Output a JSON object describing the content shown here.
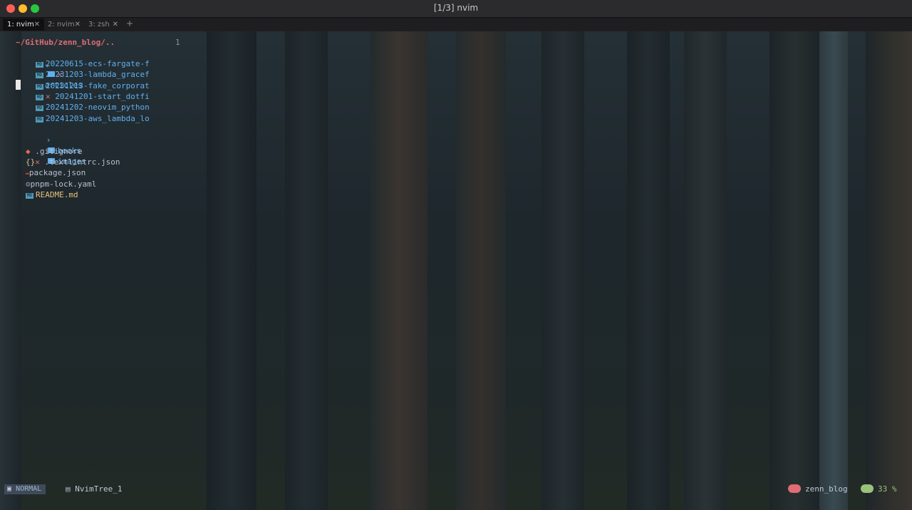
{
  "window": {
    "title": "[1/3] nvim"
  },
  "tabs": [
    {
      "label": "1: nvim",
      "close": "✕"
    },
    {
      "label": "2: nvim",
      "close": "✕"
    },
    {
      "label": "3: zsh",
      "close": "✕"
    }
  ],
  "tab_add": "+",
  "tree": {
    "root": "~/GitHub/zenn_blog/..",
    "line_number": "1",
    "articles": {
      "label": "articles",
      "status": "✕"
    },
    "article_files": [
      "20220615-ecs-fargate-f",
      "20231203-lambda_gracef",
      "20231213-fake_corporat",
      "20241201-start_dotfi",
      "20241202-neovim_python",
      "20241203-aws_lambda_lo"
    ],
    "file_status_mark": "✕",
    "dirs": [
      "books",
      "images"
    ],
    "root_files": {
      "gitignore": ".gitignore",
      "textlint": ".textlintrc.json",
      "package": "package.json",
      "pnpm": "pnpm-lock.yaml",
      "readme": "README.md"
    },
    "icons": {
      "md": "MD",
      "json": "{}",
      "chevron_down": "⌄",
      "chevron_right": "›"
    }
  },
  "statusline": {
    "mode": "NORMAL",
    "file": "NvimTree_1",
    "project": "zenn_blog",
    "percent": "33 %"
  },
  "colors": {
    "accent_red": "#e06c75",
    "dir_blue": "#61afef",
    "green": "#98c379",
    "yellow": "#e5c07b"
  }
}
